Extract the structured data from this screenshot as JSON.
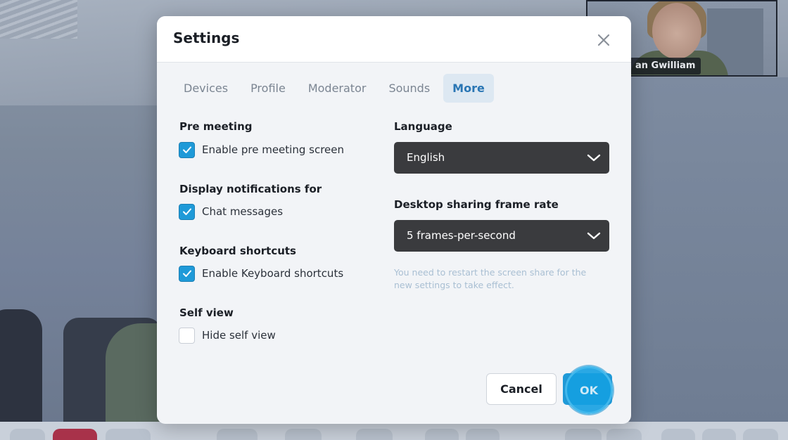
{
  "thumbnail": {
    "name": "an Gwilliam"
  },
  "dialog": {
    "title": "Settings",
    "tabs": [
      {
        "label": "Devices",
        "active": false
      },
      {
        "label": "Profile",
        "active": false
      },
      {
        "label": "Moderator",
        "active": false
      },
      {
        "label": "Sounds",
        "active": false
      },
      {
        "label": "More",
        "active": true
      }
    ],
    "left": {
      "pre_meeting": {
        "title": "Pre meeting",
        "option": "Enable pre meeting screen",
        "checked": true
      },
      "notifications": {
        "title": "Display notifications for",
        "option": "Chat messages",
        "checked": true
      },
      "shortcuts": {
        "title": "Keyboard shortcuts",
        "option": "Enable Keyboard shortcuts",
        "checked": true
      },
      "self_view": {
        "title": "Self view",
        "option": "Hide self view",
        "checked": false
      }
    },
    "right": {
      "language": {
        "title": "Language",
        "value": "English"
      },
      "frame_rate": {
        "title": "Desktop sharing frame rate",
        "value": "5 frames-per-second",
        "hint": "You need to restart the screen share for the new settings to take effect."
      }
    },
    "buttons": {
      "cancel": "Cancel",
      "ok": "OK"
    }
  },
  "colors": {
    "accent": "#1f9ad8",
    "active_tab_bg": "#dde8f2",
    "active_tab_text": "#2a76b4",
    "select_bg": "#3a3b3e",
    "hint_text": "#a9bfd3"
  },
  "icons": [
    "close-icon",
    "checkmark-icon",
    "chevron-down-icon"
  ]
}
